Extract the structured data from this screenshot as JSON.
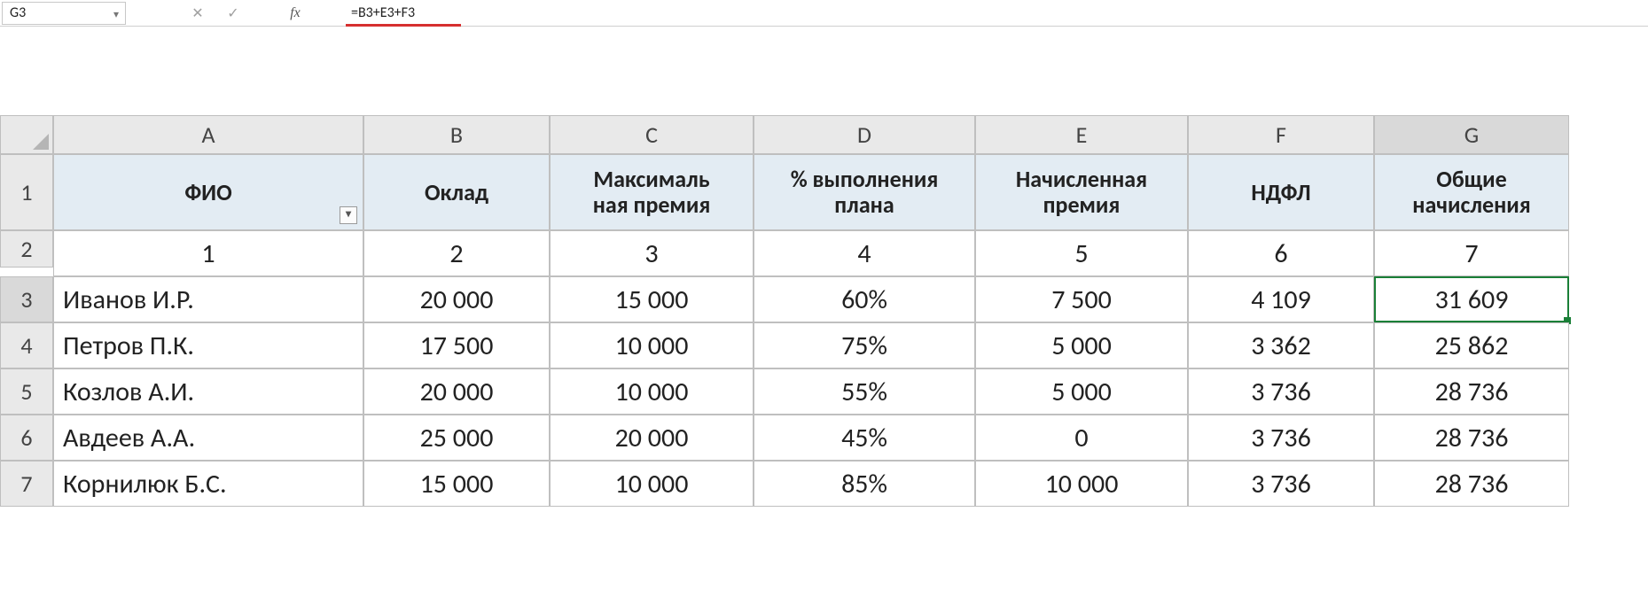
{
  "name_box": "G3",
  "formula": "=B3+E3+F3",
  "columns": [
    "A",
    "B",
    "C",
    "D",
    "E",
    "F",
    "G"
  ],
  "row_numbers": [
    "1",
    "2",
    "3",
    "4",
    "5",
    "6",
    "7"
  ],
  "active_col_index": 6,
  "active_row_index": 2,
  "headers": [
    "ФИО",
    "Оклад",
    "Максималь\nная премия",
    "% выполнения плана",
    "Начисленная премия",
    "НДФЛ",
    "Общие начисления"
  ],
  "index_row": [
    "1",
    "2",
    "3",
    "4",
    "5",
    "6",
    "7"
  ],
  "rows": [
    {
      "fio": "Иванов И.Р.",
      "oklad": "20 000",
      "maxprem": "15 000",
      "pct": "60%",
      "accr": "7 500",
      "ndfl": "4 109",
      "total": "31 609"
    },
    {
      "fio": "Петров П.К.",
      "oklad": "17 500",
      "maxprem": "10 000",
      "pct": "75%",
      "accr": "5 000",
      "ndfl": "3 362",
      "total": "25 862"
    },
    {
      "fio": "Козлов А.И.",
      "oklad": "20 000",
      "maxprem": "10 000",
      "pct": "55%",
      "accr": "5 000",
      "ndfl": "3 736",
      "total": "28 736"
    },
    {
      "fio": "Авдеев А.А.",
      "oklad": "25 000",
      "maxprem": "20 000",
      "pct": "45%",
      "accr": "0",
      "ndfl": "3 736",
      "total": "28 736"
    },
    {
      "fio": "Корнилюк Б.С.",
      "oklad": "15 000",
      "maxprem": "10 000",
      "pct": "85%",
      "accr": "10 000",
      "ndfl": "3 736",
      "total": "28 736"
    }
  ],
  "icons": {
    "cancel": "✕",
    "enter": "✓",
    "fx": "fx"
  }
}
